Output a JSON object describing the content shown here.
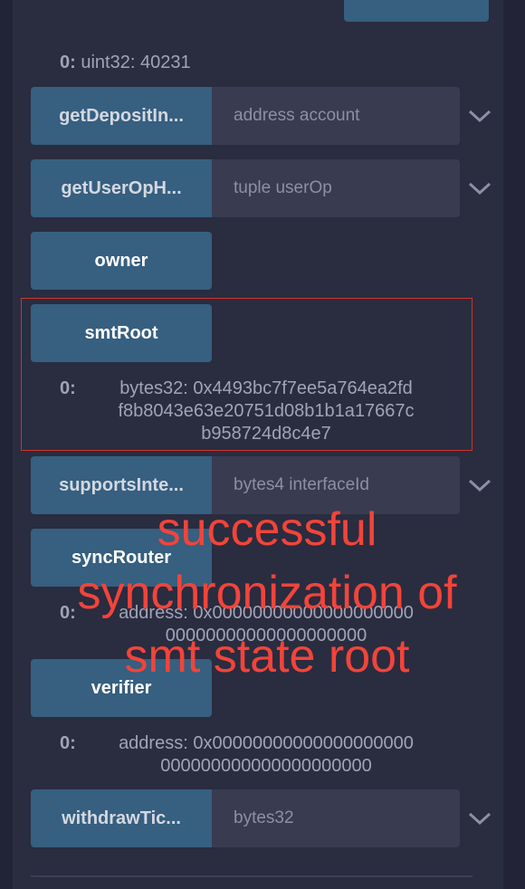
{
  "top_output": {
    "index": "0:",
    "value": "uint32: 40231"
  },
  "functions": [
    {
      "name": "getDepositIn...",
      "placeholder": "address account"
    },
    {
      "name": "getUserOpH...",
      "placeholder": "tuple userOp"
    },
    {
      "name": "owner"
    },
    {
      "name": "smtRoot",
      "output": {
        "index": "0:",
        "lines": [
          "bytes32: 0x4493bc7f7ee5a764ea2fd",
          "f8b8043e63e20751d08b1b1a17667c",
          "b958724d8c4e7"
        ]
      }
    },
    {
      "name": "supportsInte...",
      "placeholder": "bytes4 interfaceId"
    },
    {
      "name": "syncRouter",
      "output": {
        "index": "0:",
        "lines": [
          "address: 0x00000000000000000000",
          "00000000000000000000"
        ]
      }
    },
    {
      "name": "verifier",
      "output": {
        "index": "0:",
        "lines": [
          "address: 0x00000000000000000000",
          "000000000000000000000"
        ]
      }
    },
    {
      "name": "withdrawTic...",
      "placeholder": "bytes32"
    }
  ],
  "annotation": {
    "lines": [
      "successful",
      "synchronization of",
      "smt state root"
    ],
    "color": "#f2443a"
  },
  "colors": {
    "button": "#365f80",
    "panel": "#2a2c3f",
    "input": "#393b50",
    "highlight_box": "#d0342c"
  }
}
